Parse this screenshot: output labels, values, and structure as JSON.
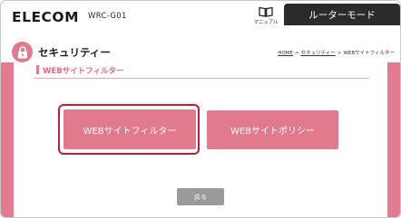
{
  "header": {
    "logo_text": "ELECOM",
    "model": "WRC-G01",
    "manual_label": "マニュアル",
    "mode_tab_label": "ルーターモード"
  },
  "page": {
    "title": "セキュリティー",
    "breadcrumb": {
      "home": "HOME",
      "separator": ">",
      "security": "セキュリティー",
      "current": "WEBサイトフィルター"
    }
  },
  "section": {
    "title": "WEBサイトフィルター"
  },
  "buttons": {
    "filter_label": "WEBサイトフィルター",
    "policy_label": "WEBサイトポリシー",
    "back_label": "戻る"
  },
  "colors": {
    "accent_pink": "#e07a8c",
    "selected_outline": "#c21d3a",
    "back_gray": "#9a9a9a",
    "mode_tab_bg": "#2b2b2b"
  },
  "icons": {
    "manual": "book-icon",
    "security": "lock-icon"
  }
}
